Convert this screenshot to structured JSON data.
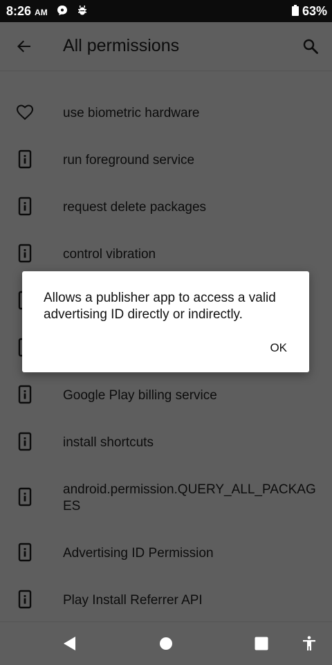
{
  "status_bar": {
    "time": "8:26",
    "ampm": "AM",
    "battery": "63%",
    "icons": [
      "chat-bubble-icon",
      "bug-icon",
      "battery-icon"
    ]
  },
  "app_bar": {
    "title": "All permissions",
    "back_icon": "arrow-back-icon",
    "search_icon": "search-icon"
  },
  "permissions": [
    {
      "label": "use biometric hardware",
      "icon": "heart-icon"
    },
    {
      "label": "run foreground service",
      "icon": "phone-info-icon"
    },
    {
      "label": "request delete packages",
      "icon": "phone-info-icon"
    },
    {
      "label": "control vibration",
      "icon": "phone-info-icon"
    },
    {
      "label": "",
      "icon": "phone-info-icon"
    },
    {
      "label": "",
      "icon": "phone-info-icon"
    },
    {
      "label": "Google Play billing service",
      "icon": "phone-info-icon"
    },
    {
      "label": "install shortcuts",
      "icon": "phone-info-icon"
    },
    {
      "label": "android.permission.QUERY_ALL_PACKAGES",
      "icon": "phone-info-icon"
    },
    {
      "label": "Advertising ID Permission",
      "icon": "phone-info-icon"
    },
    {
      "label": "Play Install Referrer API",
      "icon": "phone-info-icon"
    }
  ],
  "dialog": {
    "message": "Allows a publisher app to access a valid advertising ID directly or indirectly.",
    "ok_label": "OK"
  },
  "nav_bar": {
    "icons": [
      "back-triangle-icon",
      "home-circle-icon",
      "recents-square-icon",
      "accessibility-icon"
    ]
  },
  "colors": {
    "status_bar": "#0c0c0c",
    "background_dimmed": "#5e5e5e",
    "dialog": "#ffffff"
  }
}
